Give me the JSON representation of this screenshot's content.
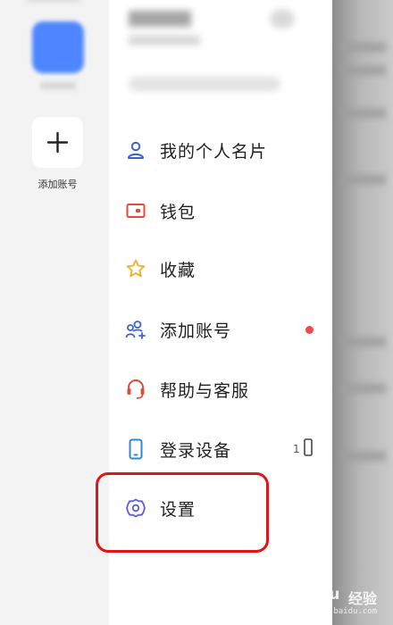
{
  "rail": {
    "add_account_label": "添加账号",
    "add_icon": "plus-icon"
  },
  "menu": {
    "items": [
      {
        "label": "我的个人名片",
        "icon": "person-icon",
        "color": "#3b63c9"
      },
      {
        "label": "钱包",
        "icon": "wallet-icon",
        "color": "#e24a3b"
      },
      {
        "label": "收藏",
        "icon": "star-icon",
        "color": "#e8b52c"
      },
      {
        "label": "添加账号",
        "icon": "add-person-icon",
        "color": "#3b63c9",
        "badge": "red-dot"
      },
      {
        "label": "帮助与客服",
        "icon": "headset-icon",
        "color": "#e24a3b"
      },
      {
        "label": "登录设备",
        "icon": "phone-icon",
        "color": "#2f86d6",
        "count": "1"
      },
      {
        "label": "设置",
        "icon": "gear-icon",
        "color": "#5b5fd0"
      }
    ]
  },
  "highlight_color": "#e01515",
  "watermark": {
    "brand": "Baidu",
    "brand_suffix": "经验",
    "url": "jingyan.baidu.com"
  }
}
